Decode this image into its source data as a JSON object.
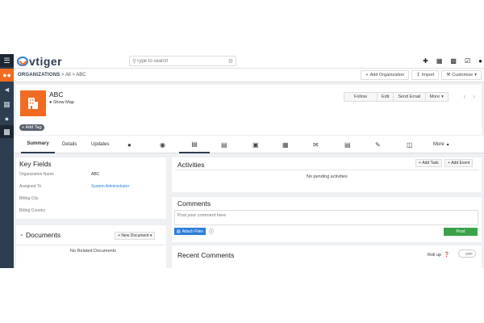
{
  "app": {
    "logo_text": "vtiger"
  },
  "search": {
    "placeholder": "Type to search"
  },
  "topbar": {
    "icons": [
      "plus-icon",
      "calendar-icon",
      "chart-icon",
      "tasks-icon",
      "user-icon"
    ]
  },
  "breadcrumb": {
    "module": "ORGANIZATIONS",
    "sep1": ">",
    "all": "All",
    "sep2": ">",
    "record": "ABC"
  },
  "header_buttons": {
    "add": "Add Organization",
    "import": "Import",
    "customize": "Customize"
  },
  "record": {
    "name": "ABC",
    "show_map": "Show Map",
    "add_tag": "Add Tag"
  },
  "record_actions": {
    "follow": "Follow",
    "edit": "Edit",
    "send_email": "Send Email",
    "more": "More"
  },
  "tabs": {
    "summary": "Summary",
    "details": "Details",
    "updates": "Updates",
    "more": "More"
  },
  "key_fields": {
    "title": "Key Fields",
    "rows": [
      {
        "label": "Organization Name",
        "value": "ABC"
      },
      {
        "label": "Assigned To",
        "value": "System Administrator"
      },
      {
        "label": "Billing City",
        "value": ""
      },
      {
        "label": "Billing Country",
        "value": ""
      }
    ]
  },
  "documents": {
    "title": "Documents",
    "new_button": "New Document",
    "empty": "No Related Documents"
  },
  "activities": {
    "title": "Activities",
    "add_task": "Add Task",
    "add_event": "Add Event",
    "empty": "No pending activities"
  },
  "comments": {
    "title": "Comments",
    "placeholder": "Post your comment here",
    "attach": "Attach Files",
    "post": "Post"
  },
  "recent_comments": {
    "title": "Recent Comments",
    "rollup": "Roll up",
    "toggle": "OFF"
  },
  "colors": {
    "accent": "#f26b22",
    "rail": "#2d3e50",
    "link": "#2d7ed6",
    "post": "#3aa34a"
  }
}
